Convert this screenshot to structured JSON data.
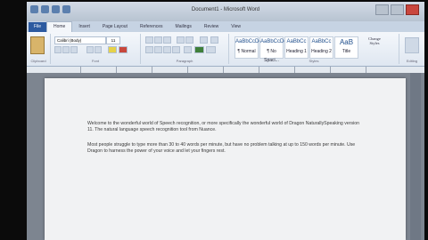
{
  "window": {
    "title": "Document1 - Microsoft Word"
  },
  "ribbon": {
    "file_tab": "File",
    "tabs": [
      "Home",
      "Insert",
      "Page Layout",
      "References",
      "Mailings",
      "Review",
      "View"
    ],
    "font_name": "Calibri (Body)",
    "font_size": "11",
    "groups": [
      "Clipboard",
      "Font",
      "Paragraph",
      "Styles",
      "Editing"
    ],
    "styles": [
      {
        "sample": "AaBbCcDc",
        "name": "¶ Normal"
      },
      {
        "sample": "AaBbCcDc",
        "name": "¶ No Spaci..."
      },
      {
        "sample": "AaBbCc",
        "name": "Heading 1"
      },
      {
        "sample": "AaBbCc",
        "name": "Heading 2"
      },
      {
        "sample": "AaB",
        "name": "Title"
      }
    ],
    "change_styles": "Change Styles"
  },
  "document": {
    "paragraphs": [
      "Welcome to the wonderful world of Speech recognition, or more specifically the wonderful world of Dragon NaturallySpeaking version 11. The natural language speech recognition tool from Nuance.",
      "Most people struggle to type more than 30 to 40 words per minute, but have no problem talking at up to 150 words per minute. Use Dragon to harness the power of your voice and let your fingers rest."
    ]
  }
}
